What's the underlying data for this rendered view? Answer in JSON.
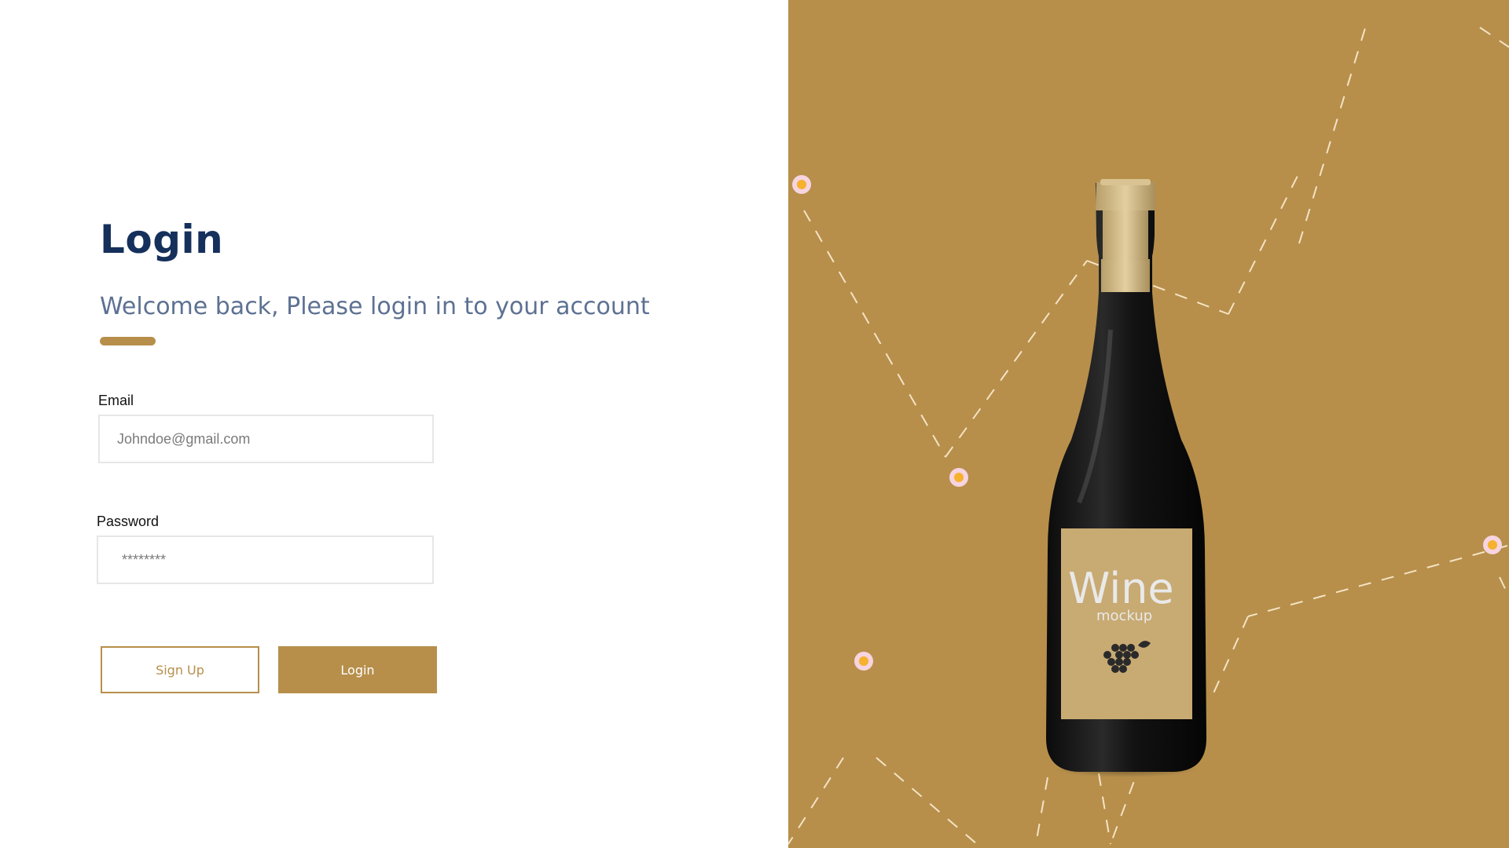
{
  "colors": {
    "accent": "#b78f4b",
    "heading": "#16305c",
    "subtitle": "#5d7192",
    "bottle_dark": "#141414",
    "bottle_cap": "#cdb57f",
    "label_bg": "#c8aa73",
    "dot_ring": "#f6d4e0",
    "dot_center": "#f6b12d",
    "dash": "#f4e3c4"
  },
  "login": {
    "title": "Login",
    "subtitle": "Welcome back, Please login in to your account",
    "email": {
      "label": "Email",
      "placeholder": "Johndoe@gmail.com",
      "value": ""
    },
    "password": {
      "label": "Password",
      "placeholder": "********",
      "value": ""
    },
    "signup_label": "Sign Up",
    "login_label": "Login"
  },
  "hero": {
    "label_title": "Wine",
    "label_subtitle": "mockup",
    "icons": [
      "grape-icon",
      "leaf-icon"
    ]
  }
}
